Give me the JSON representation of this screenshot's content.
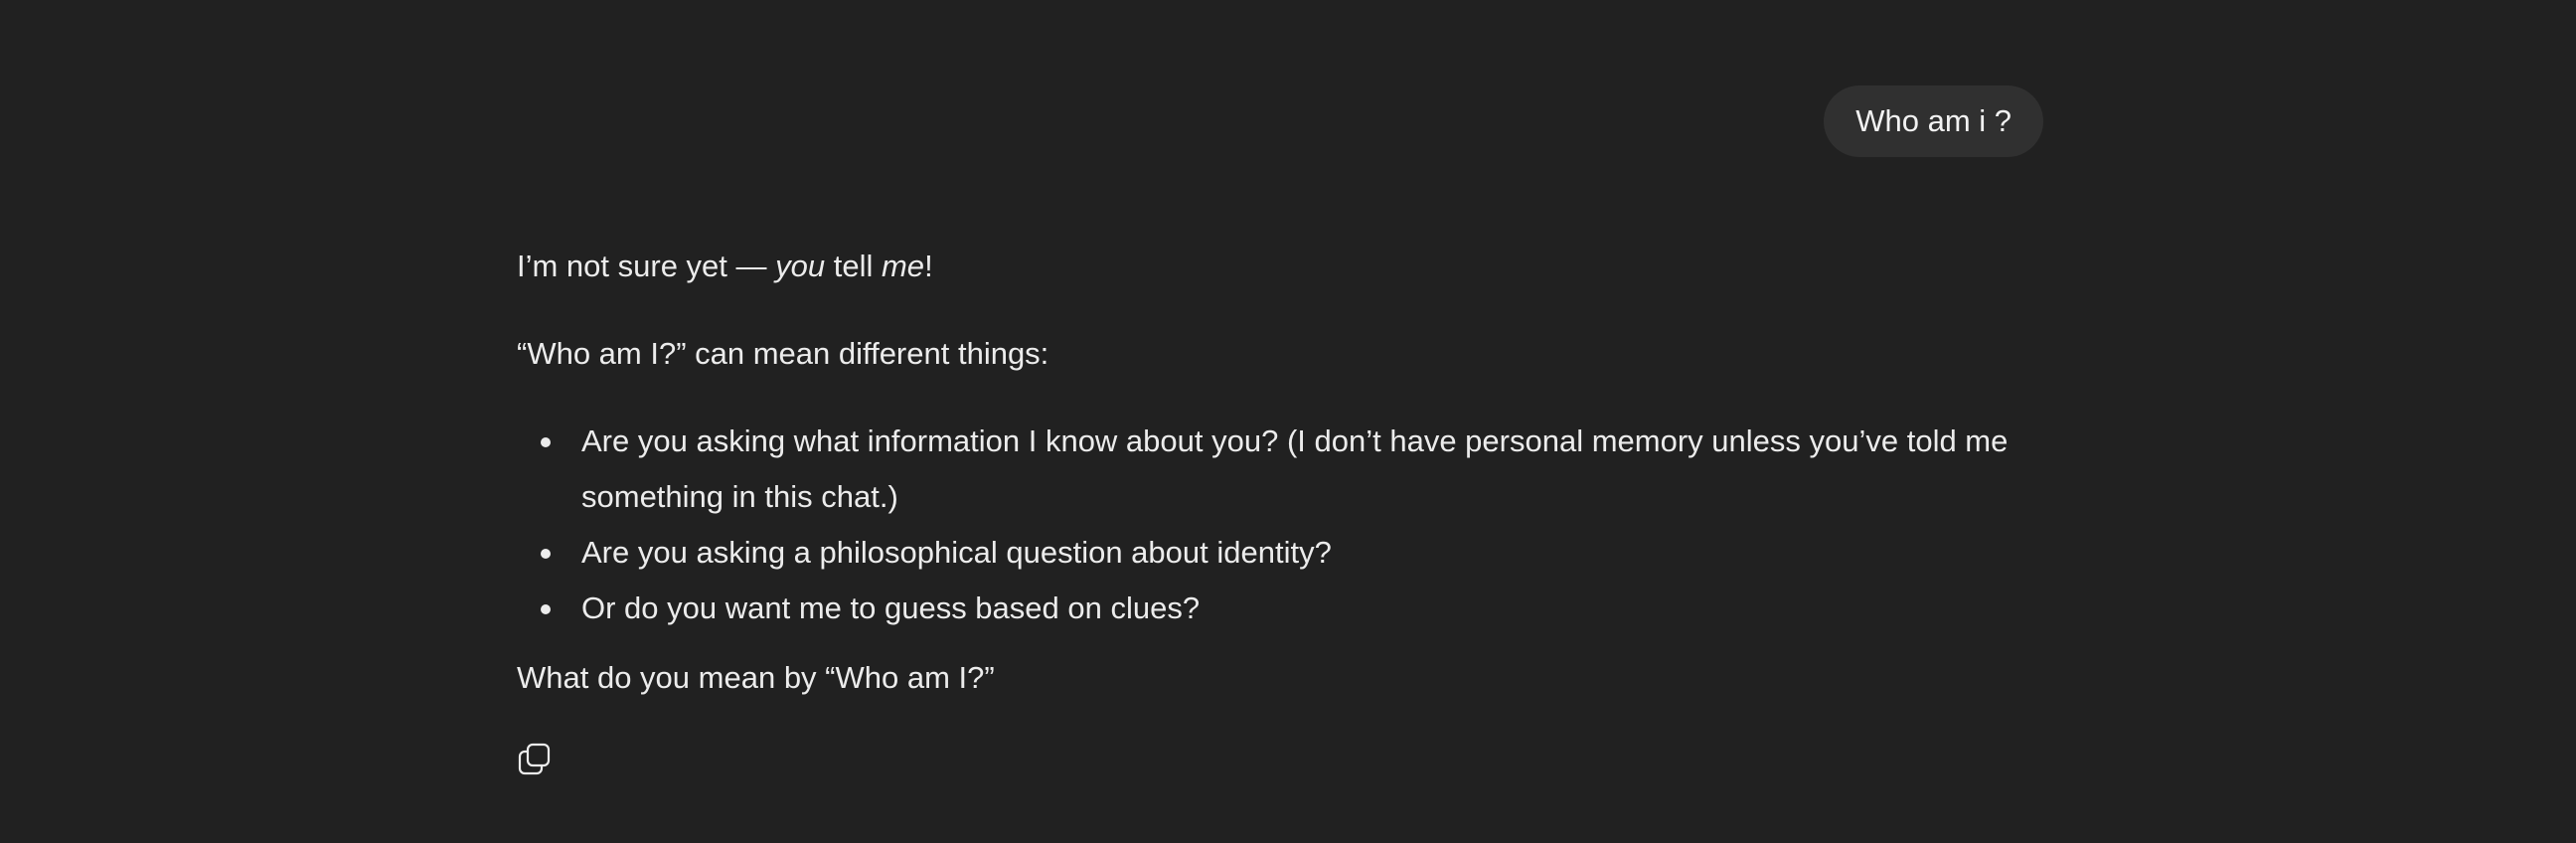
{
  "user_message": {
    "text": "Who am i ?"
  },
  "assistant_message": {
    "intro": {
      "prefix": "I’m not sure yet — ",
      "em1": "you",
      "middle": " tell ",
      "em2": "me",
      "suffix": "!"
    },
    "question_line": "“Who am I?” can mean different things:",
    "bullets": [
      "Are you asking what information I know about you? (I don’t have personal memory unless you’ve told me something in this chat.)",
      "Are you asking a philosophical question about identity?",
      "Or do you want me to guess based on clues?"
    ],
    "closing": "What do you mean by “Who am I?”"
  },
  "actions": {
    "copy_icon": "copy-icon"
  }
}
